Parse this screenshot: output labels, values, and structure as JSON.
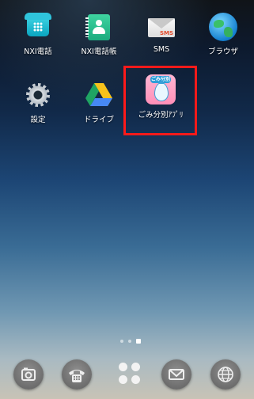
{
  "home_screen": {
    "apps_row1": [
      {
        "label": "NXI電話",
        "icon": "phone-icon"
      },
      {
        "label": "NXI電話帳",
        "icon": "contacts-icon"
      },
      {
        "label": "SMS",
        "icon": "sms-envelope-icon",
        "icon_text": "SMS"
      },
      {
        "label": "ブラウザ",
        "icon": "globe-icon"
      }
    ],
    "apps_row2": [
      {
        "label": "設定",
        "icon": "gear-icon"
      },
      {
        "label": "ドライブ",
        "icon": "drive-icon"
      },
      {
        "label": "ごみ分別ｱﾌﾟﾘ",
        "icon": "gomi-app-icon",
        "icon_text": "ごみ分別"
      }
    ],
    "highlight_color": "#ff1a1a",
    "page_indicator": {
      "pages": 3,
      "active": 3
    }
  },
  "dock": [
    {
      "icon": "camera-icon"
    },
    {
      "icon": "phone-dial-icon"
    },
    {
      "icon": "app-drawer-icon"
    },
    {
      "icon": "mail-icon"
    },
    {
      "icon": "browser-globe-icon"
    }
  ]
}
